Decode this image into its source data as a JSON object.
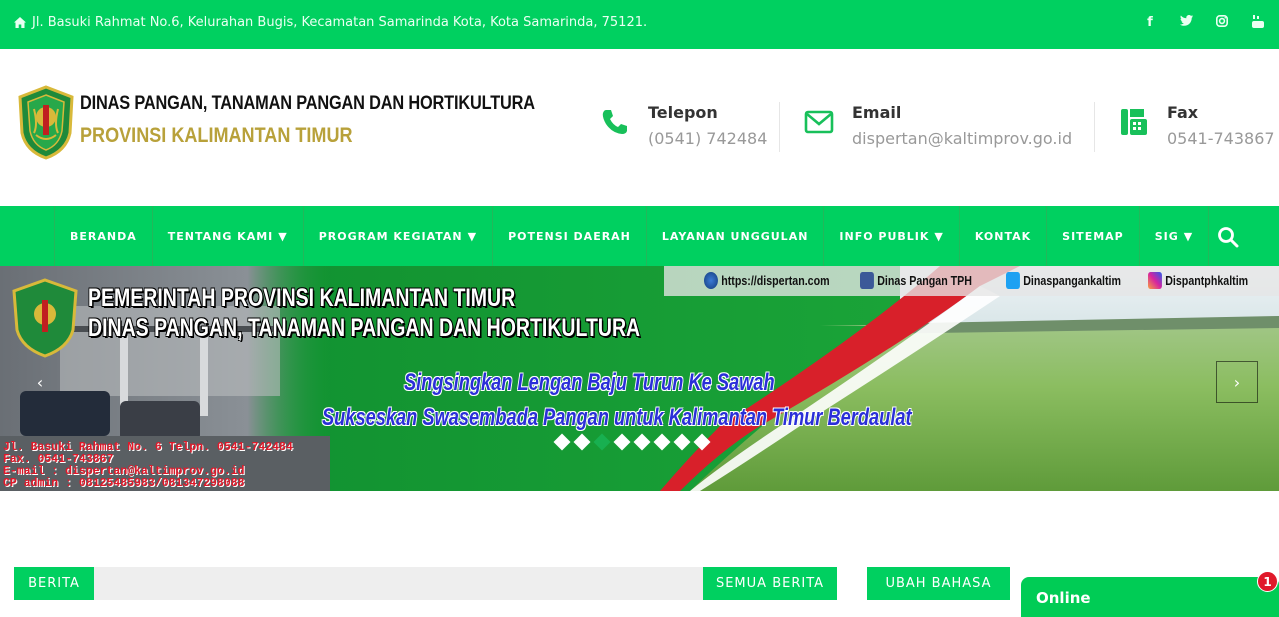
{
  "topbar": {
    "address": "Jl. Basuki Rahmat No.6, Kelurahan Bugis, Kecamatan Samarinda Kota, Kota Samarinda, 75121.",
    "social": [
      "facebook-icon",
      "twitter-icon",
      "instagram-icon",
      "youtube-icon"
    ]
  },
  "header": {
    "org_name": "DINAS PANGAN, TANAMAN PANGAN DAN HORTIKULTURA",
    "province": "PROVINSI KALIMANTAN TIMUR",
    "phone": {
      "label": "Telepon",
      "value": "(0541) 742484"
    },
    "email": {
      "label": "Email",
      "value": "dispertan@kaltimprov.go.id"
    },
    "fax": {
      "label": "Fax",
      "value": "0541-743867"
    }
  },
  "nav": {
    "items": [
      {
        "label": "BERANDA"
      },
      {
        "label": "TENTANG KAMI",
        "caret": "▼"
      },
      {
        "label": "PROGRAM KEGIATAN",
        "caret": "▼"
      },
      {
        "label": "POTENSI DAERAH"
      },
      {
        "label": "LAYANAN UNGGULAN"
      },
      {
        "label": "INFO PUBLIK",
        "caret": "▼"
      },
      {
        "label": "KONTAK"
      },
      {
        "label": "SITEMAP"
      },
      {
        "label": "SIG",
        "caret": "▼"
      }
    ]
  },
  "slider": {
    "title1": "PEMERINTAH PROVINSI KALIMANTAN TIMUR",
    "title2": "DINAS PANGAN, TANAMAN PANGAN DAN HORTIKULTURA",
    "slogan1": "Singsingkan Lengan Baju Turun Ke Sawah",
    "slogan2": "Sukseskan Swasembada Pangan untuk Kalimantan Timur Berdaulat",
    "info": [
      "Jl. Basuki Rahmat No. 6 Telpn. 0541-742484",
      "Fax. 0541-743867",
      "E-mail : dispertan@kaltimprov.go.id",
      "CP admin : 08125485983/081347298088"
    ],
    "links": {
      "web": "https://dispertan.com",
      "facebook": "Dinas Pangan TPH",
      "twitter": "Dinaspangankaltim",
      "instagram": "Dispantphkaltim"
    },
    "prev": "‹",
    "next": "›",
    "dot_count": 8,
    "active_dot": 2
  },
  "sections": {
    "berita": "BERITA",
    "semua_berita": "SEMUA BERITA",
    "ubah_bahasa": "UBAH BAHASA"
  },
  "chat": {
    "status": "Online",
    "badge": "1"
  },
  "colors": {
    "brand_green": "#00d060",
    "emblem_gold": "#b8a13a",
    "slogan_blue": "#2a2fd8",
    "info_red": "#e0192a"
  }
}
